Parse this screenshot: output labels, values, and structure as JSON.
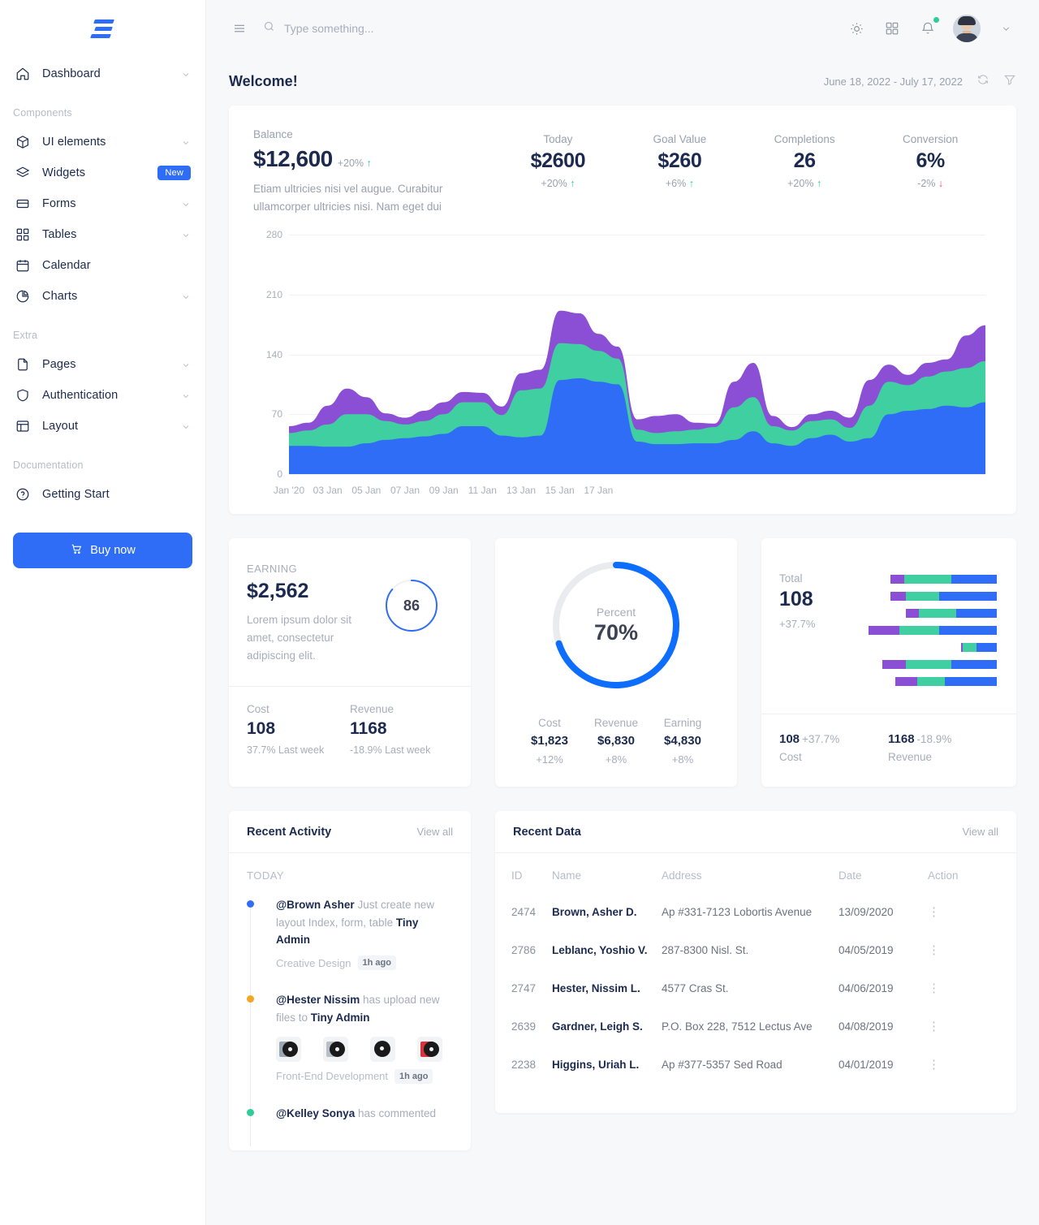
{
  "brand": {
    "logo_name": "tiny-admin-logo"
  },
  "sidebar": {
    "primary": [
      {
        "label": "Dashboard",
        "icon": "home-icon",
        "chevron": true
      }
    ],
    "sections": [
      {
        "label": "Components",
        "items": [
          {
            "label": "UI elements",
            "icon": "cube-icon",
            "chevron": true
          },
          {
            "label": "Widgets",
            "icon": "layers-icon",
            "badge": "New"
          },
          {
            "label": "Forms",
            "icon": "form-icon",
            "chevron": true
          },
          {
            "label": "Tables",
            "icon": "grid-icon",
            "chevron": true
          },
          {
            "label": "Calendar",
            "icon": "calendar-icon"
          },
          {
            "label": "Charts",
            "icon": "pie-chart-icon",
            "chevron": true
          }
        ]
      },
      {
        "label": "Extra",
        "items": [
          {
            "label": "Pages",
            "icon": "file-icon",
            "chevron": true
          },
          {
            "label": "Authentication",
            "icon": "shield-icon",
            "chevron": true
          },
          {
            "label": "Layout",
            "icon": "layout-icon",
            "chevron": true
          }
        ]
      },
      {
        "label": "Documentation",
        "items": [
          {
            "label": "Getting Start",
            "icon": "help-circle-icon"
          }
        ]
      }
    ],
    "buy_button": "Buy now"
  },
  "topbar": {
    "menu_icon": "hamburger-icon",
    "search_placeholder": "Type something...",
    "search_value": "",
    "theme_icon": "sun-icon",
    "apps_icon": "grid-apps-icon",
    "bell_icon": "bell-icon",
    "avatar_name": "user-avatar"
  },
  "page": {
    "title": "Welcome!",
    "date_range": "June 18, 2022 - July 17, 2022",
    "refresh_icon": "refresh-icon",
    "filter_icon": "filter-icon"
  },
  "hero": {
    "balance_label": "Balance",
    "balance_value": "$12,600",
    "balance_delta": "+20%",
    "balance_delta_dir": "up",
    "description": "Etiam ultricies nisi vel augue. Curabitur ullamcorper ultricies nisi. Nam eget dui",
    "kpis": [
      {
        "label": "Today",
        "value": "$2600",
        "delta": "+20%",
        "dir": "up"
      },
      {
        "label": "Goal Value",
        "value": "$260",
        "delta": "+6%",
        "dir": "up"
      },
      {
        "label": "Completions",
        "value": "26",
        "delta": "+20%",
        "dir": "up"
      },
      {
        "label": "Conversion",
        "value": "6%",
        "delta": "-2%",
        "dir": "down"
      }
    ]
  },
  "chart_data": {
    "type": "area",
    "title": "",
    "xlabel": "",
    "ylabel": "",
    "ylim": [
      0,
      280
    ],
    "yticks": [
      0,
      70,
      140,
      210,
      280
    ],
    "xticks": [
      "Jan '20",
      "03 Jan",
      "05 Jan",
      "07 Jan",
      "09 Jan",
      "11 Jan",
      "13 Jan",
      "15 Jan",
      "17 Jan"
    ],
    "grid": true,
    "legend": "none",
    "stacked": true,
    "colors": {
      "series1": "#2f6df6",
      "series2": "#3fcfa0",
      "series3": "#8b4fd6"
    },
    "x": [
      1,
      2,
      3,
      4,
      5,
      6,
      7,
      8,
      9,
      10,
      11,
      12,
      13,
      14,
      15,
      16,
      17,
      18,
      19,
      20,
      21,
      22,
      23,
      24,
      25,
      26,
      27,
      28,
      29,
      30,
      31,
      32,
      33,
      34,
      35,
      36,
      37
    ],
    "series": [
      {
        "name": "Series 1",
        "values": [
          33,
          33,
          32,
          32,
          36,
          40,
          42,
          44,
          47,
          56,
          56,
          45,
          43,
          45,
          110,
          112,
          108,
          105,
          38,
          35,
          35,
          36,
          36,
          40,
          50,
          36,
          33,
          42,
          46,
          38,
          42,
          70,
          74,
          76,
          80,
          78,
          84
        ]
      },
      {
        "name": "Series 2",
        "values": [
          15,
          18,
          26,
          38,
          34,
          22,
          16,
          18,
          23,
          28,
          28,
          24,
          55,
          55,
          43,
          40,
          36,
          30,
          14,
          13,
          15,
          16,
          19,
          38,
          40,
          20,
          18,
          20,
          18,
          16,
          38,
          38,
          30,
          38,
          40,
          46,
          48
        ]
      },
      {
        "name": "Series 3",
        "values": [
          8,
          9,
          22,
          30,
          20,
          9,
          8,
          12,
          14,
          12,
          11,
          10,
          20,
          22,
          38,
          36,
          20,
          14,
          12,
          20,
          20,
          8,
          4,
          30,
          40,
          12,
          4,
          8,
          10,
          12,
          30,
          20,
          12,
          16,
          14,
          38,
          42
        ]
      }
    ]
  },
  "earning_card": {
    "caption": "EARNING",
    "value": "$2,562",
    "description": "Lorem ipsum dolor sit amet, consectetur adipiscing elit.",
    "gauge_value": "86",
    "gauge_percent": 86,
    "footer": [
      {
        "label": "Cost",
        "value": "108",
        "sub": "37.7% Last week"
      },
      {
        "label": "Revenue",
        "value": "1168",
        "sub": "-18.9% Last week"
      }
    ]
  },
  "percent_card": {
    "gauge_label": "Percent",
    "gauge_value": "70%",
    "gauge_percent": 70,
    "footer": [
      {
        "label": "Cost",
        "value": "$1,823",
        "sub": "+12%"
      },
      {
        "label": "Revenue",
        "value": "$6,830",
        "sub": "+8%"
      },
      {
        "label": "Earning",
        "value": "$4,830",
        "sub": "+8%"
      }
    ]
  },
  "total_card": {
    "label": "Total",
    "value": "108",
    "sub": "+37.7%",
    "bars": [
      {
        "purple": 8,
        "green": 28,
        "blue": 27
      },
      {
        "purple": 9,
        "green": 20,
        "blue": 34
      },
      {
        "purple": 8,
        "green": 22,
        "blue": 24
      },
      {
        "purple": 20,
        "green": 26,
        "blue": 38
      },
      {
        "purple": 1,
        "green": 8,
        "blue": 12
      },
      {
        "purple": 14,
        "green": 27,
        "blue": 27
      },
      {
        "purple": 13,
        "green": 16,
        "blue": 31
      }
    ],
    "footer": [
      {
        "value": "108",
        "delta": "+37.7%",
        "label": "Cost"
      },
      {
        "value": "1168",
        "delta": "-18.9%",
        "label": "Revenue"
      }
    ]
  },
  "activity": {
    "title": "Recent Activity",
    "view_all": "View all",
    "group_label": "TODAY",
    "items": [
      {
        "dot_color": "#2f6df6",
        "user": "@Brown Asher",
        "text": " Just create new layout Index, form, table ",
        "target": "Tiny Admin",
        "meta": "Creative Design",
        "time": "1h ago",
        "thumbs": []
      },
      {
        "dot_color": "#f5a623",
        "user": "@Hester Nissim",
        "text": " has upload new files to ",
        "target": "Tiny Admin",
        "meta": "Front-End Development",
        "time": "1h ago",
        "thumbs": [
          "#9aa7b4",
          "#b9bfc6",
          "#111111",
          "#d8323c"
        ]
      },
      {
        "dot_color": "#2ecc9b",
        "user": "@Kelley Sonya",
        "text": " has commented",
        "target": "",
        "meta": "",
        "time": "",
        "thumbs": []
      }
    ]
  },
  "recent_data": {
    "title": "Recent Data",
    "view_all": "View all",
    "columns": [
      "ID",
      "Name",
      "Address",
      "Date",
      "Action"
    ],
    "rows": [
      {
        "id": "2474",
        "name": "Brown, Asher D.",
        "address": "Ap #331-7123 Lobortis Avenue",
        "date": "13/09/2020",
        "action": "kebab-menu-icon"
      },
      {
        "id": "2786",
        "name": "Leblanc, Yoshio V.",
        "address": "287-8300 Nisl. St.",
        "date": "04/05/2019",
        "action": "kebab-menu-icon"
      },
      {
        "id": "2747",
        "name": "Hester, Nissim L.",
        "address": "4577 Cras St.",
        "date": "04/06/2019",
        "action": "kebab-menu-icon"
      },
      {
        "id": "2639",
        "name": "Gardner, Leigh S.",
        "address": "P.O. Box 228, 7512 Lectus Ave",
        "date": "04/08/2019",
        "action": "kebab-menu-icon"
      },
      {
        "id": "2238",
        "name": "Higgins, Uriah L.",
        "address": "Ap #377-5357 Sed Road",
        "date": "04/01/2019",
        "action": "kebab-menu-icon"
      }
    ]
  },
  "colors": {
    "accent": "#2f6df6",
    "green": "#3fcfa0",
    "purple": "#8b4fd6",
    "danger": "#f0506e",
    "text": "#1b2a4e",
    "muted": "#a7adba"
  }
}
